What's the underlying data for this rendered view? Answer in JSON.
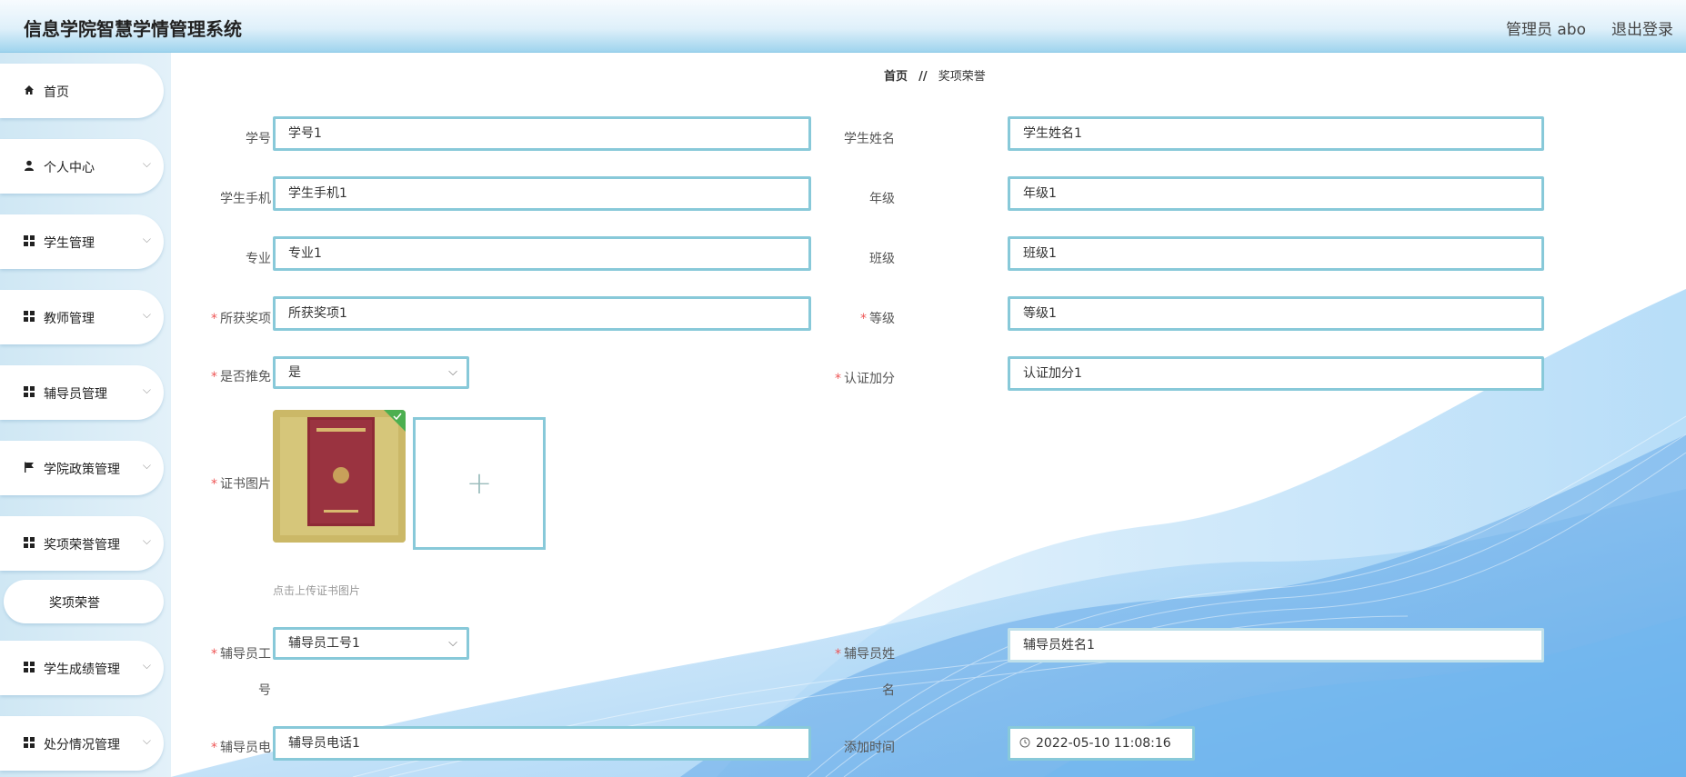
{
  "header": {
    "title": "信息学院智慧学情管理系统",
    "user": "管理员 abo",
    "logout": "退出登录"
  },
  "sidebar": {
    "items": [
      {
        "label": "首页"
      },
      {
        "label": "个人中心"
      },
      {
        "label": "学生管理"
      },
      {
        "label": "教师管理"
      },
      {
        "label": "辅导员管理"
      },
      {
        "label": "学院政策管理"
      },
      {
        "label": "奖项荣誉管理"
      },
      {
        "label": "学生成绩管理"
      },
      {
        "label": "处分情况管理"
      }
    ],
    "sub_item": "奖项荣誉"
  },
  "breadcrumb": {
    "home": "首页",
    "sep": "//",
    "current": "奖项荣誉"
  },
  "form": {
    "student_id": {
      "label": "学号",
      "value": "学号1"
    },
    "student_name": {
      "label": "学生姓名",
      "value": "学生姓名1"
    },
    "student_phone": {
      "label": "学生手机",
      "value": "学生手机1"
    },
    "grade": {
      "label": "年级",
      "value": "年级1"
    },
    "major": {
      "label": "专业",
      "value": "专业1"
    },
    "class_name": {
      "label": "班级",
      "value": "班级1"
    },
    "award": {
      "label": "所获奖项",
      "value": "所获奖项1"
    },
    "level": {
      "label": "等级",
      "value": "等级1"
    },
    "recommend": {
      "label": "是否推免",
      "value": "是"
    },
    "bonus": {
      "label": "认证加分",
      "value": "认证加分1"
    },
    "certificate": {
      "label": "证书图片",
      "hint": "点击上传证书图片"
    },
    "counselor_id": {
      "label_line1": "辅导员工",
      "label_line2": "号",
      "value": "辅导员工号1"
    },
    "counselor_name": {
      "label_line1": "辅导员姓",
      "label_line2": "名",
      "value": "辅导员姓名1"
    },
    "counselor_phone": {
      "label": "辅导员电",
      "value": "辅导员电话1"
    },
    "added_time": {
      "label": "添加时间",
      "value": "2022-05-10 11:08:16"
    }
  },
  "colors": {
    "input_border": "#88c9d9",
    "required": "#e55",
    "header_bottom": "#9fd4ee"
  }
}
